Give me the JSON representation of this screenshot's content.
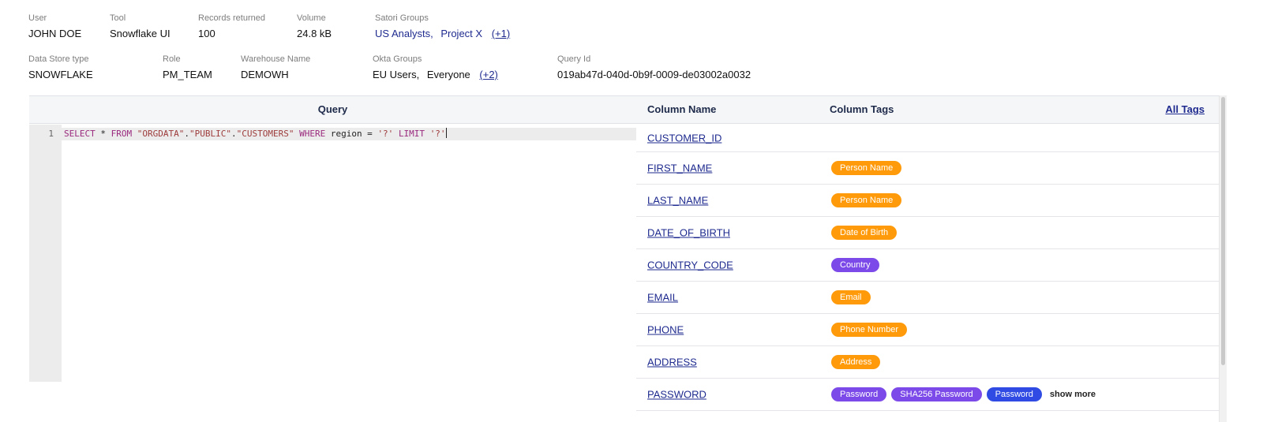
{
  "meta_row1": {
    "user": {
      "label": "User",
      "value": "JOHN DOE"
    },
    "tool": {
      "label": "Tool",
      "value": "Snowflake UI"
    },
    "records": {
      "label": "Records returned",
      "value": "100"
    },
    "volume": {
      "label": "Volume",
      "value": "24.8 kB"
    },
    "satori_groups": {
      "label": "Satori Groups",
      "items": [
        "US Analysts,",
        "Project X"
      ],
      "more": "(+1)"
    }
  },
  "meta_row2": {
    "datastore": {
      "label": "Data Store type",
      "value": "SNOWFLAKE"
    },
    "role": {
      "label": "Role",
      "value": "PM_TEAM"
    },
    "warehouse": {
      "label": "Warehouse Name",
      "value": "DEMOWH"
    },
    "okta_groups": {
      "label": "Okta Groups",
      "items": [
        "EU Users,",
        "Everyone"
      ],
      "more": "(+2)"
    },
    "query_id": {
      "label": "Query Id",
      "value": "019ab47d-040d-0b9f-0009-de03002a0032"
    }
  },
  "query_panel": {
    "title": "Query",
    "line_number": "1",
    "code_tokens": [
      {
        "t": "kw",
        "v": "SELECT"
      },
      {
        "t": "plain",
        "v": " * "
      },
      {
        "t": "kw",
        "v": "FROM"
      },
      {
        "t": "plain",
        "v": " "
      },
      {
        "t": "str",
        "v": "\"ORGDATA\""
      },
      {
        "t": "plain",
        "v": "."
      },
      {
        "t": "str",
        "v": "\"PUBLIC\""
      },
      {
        "t": "plain",
        "v": "."
      },
      {
        "t": "str",
        "v": "\"CUSTOMERS\""
      },
      {
        "t": "plain",
        "v": " "
      },
      {
        "t": "kw",
        "v": "WHERE"
      },
      {
        "t": "plain",
        "v": " region = "
      },
      {
        "t": "str",
        "v": "'?'"
      },
      {
        "t": "plain",
        "v": " "
      },
      {
        "t": "kw",
        "v": "LIMIT"
      },
      {
        "t": "plain",
        "v": " "
      },
      {
        "t": "str",
        "v": "'?'"
      }
    ]
  },
  "columns_table": {
    "header_name": "Column Name",
    "header_tags": "Column Tags",
    "all_tags": "All Tags",
    "show_more": "show more",
    "colors": {
      "orange": "#ff9a0a",
      "purple": "#7c4ae8",
      "blue": "#2f4be3"
    },
    "rows": [
      {
        "name": "CUSTOMER_ID",
        "tags": []
      },
      {
        "name": "FIRST_NAME",
        "tags": [
          {
            "label": "Person Name",
            "color": "orange"
          }
        ]
      },
      {
        "name": "LAST_NAME",
        "tags": [
          {
            "label": "Person Name",
            "color": "orange"
          }
        ]
      },
      {
        "name": "DATE_OF_BIRTH",
        "tags": [
          {
            "label": "Date of Birth",
            "color": "orange"
          }
        ]
      },
      {
        "name": "COUNTRY_CODE",
        "tags": [
          {
            "label": "Country",
            "color": "purple"
          }
        ]
      },
      {
        "name": "EMAIL",
        "tags": [
          {
            "label": "Email",
            "color": "orange"
          }
        ]
      },
      {
        "name": "PHONE",
        "tags": [
          {
            "label": "Phone Number",
            "color": "orange"
          }
        ]
      },
      {
        "name": "ADDRESS",
        "tags": [
          {
            "label": "Address",
            "color": "orange"
          }
        ]
      },
      {
        "name": "PASSWORD",
        "tags": [
          {
            "label": "Password",
            "color": "purple"
          },
          {
            "label": "SHA256 Password",
            "color": "purple"
          },
          {
            "label": "Password",
            "color": "blue"
          }
        ],
        "show_more": true
      }
    ]
  }
}
